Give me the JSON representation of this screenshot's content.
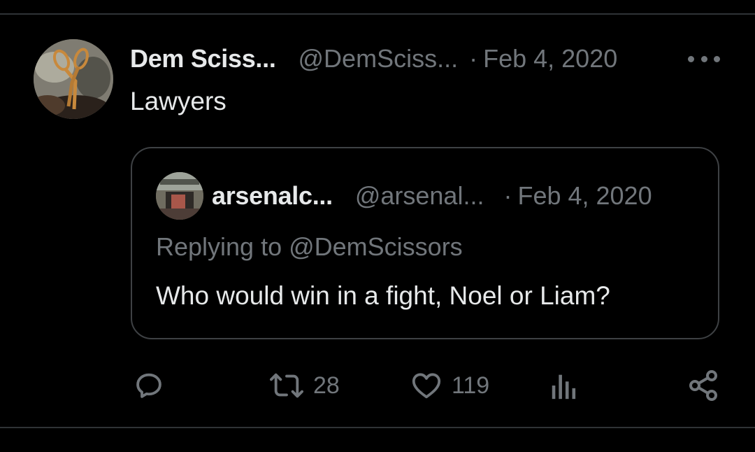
{
  "tweet": {
    "author_name": "Dem Sciss...",
    "author_handle": "@DemSciss...",
    "date_separator": "·",
    "date": "Feb 4, 2020",
    "text": "Lawyers"
  },
  "quoted_tweet": {
    "author_name": "arsenalc...",
    "author_handle": "@arsenal...",
    "date_separator": "·",
    "date": "Feb 4, 2020",
    "replying_to": "Replying to @DemScissors",
    "text": "Who would win in a fight, Noel or Liam?"
  },
  "actions": {
    "reply_icon": "reply-icon",
    "retweet_icon": "retweet-icon",
    "retweet_count": "28",
    "like_icon": "heart-icon",
    "like_count": "119",
    "analytics_icon": "analytics-icon",
    "share_icon": "share-icon"
  },
  "colors": {
    "background": "#000000",
    "primary_text": "#e7e9ea",
    "secondary_text": "#71767b",
    "border": "#3e4144",
    "divider": "#2f3336"
  }
}
